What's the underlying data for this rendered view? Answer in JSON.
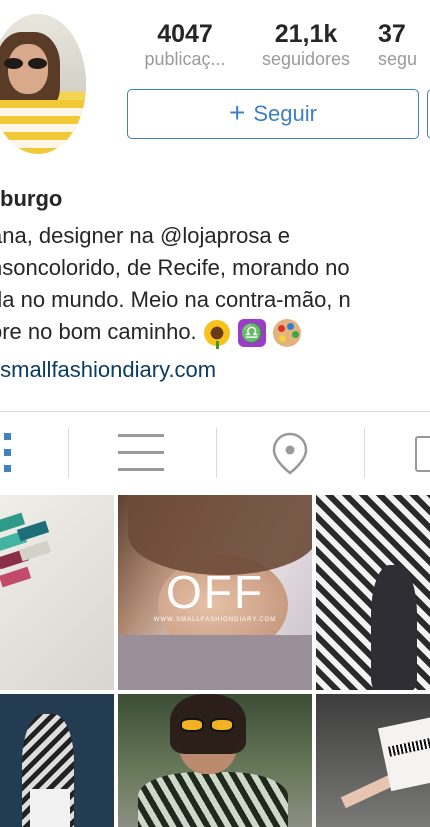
{
  "profile": {
    "stats": [
      {
        "count": "4047",
        "label": "publicaç..."
      },
      {
        "count": "21,1k",
        "label": "seguidores"
      },
      {
        "count": "37",
        "label": "segu"
      }
    ],
    "follow_label": "Seguir",
    "username": "burgo",
    "bio_lines": [
      "ana, designer na @lojaprosa e",
      "nsoncolorido, de Recife, morando no",
      "da no mundo. Meio na contra-mão, n",
      "ore no bom caminho."
    ],
    "bio_emojis": [
      "sunflower-emoji",
      "libra-emoji",
      "palette-emoji"
    ],
    "link": ".smallfashiondiary.com"
  },
  "tabs": [
    {
      "icon": "grid-icon",
      "active": true
    },
    {
      "icon": "list-icon",
      "active": false
    },
    {
      "icon": "location-pin-icon",
      "active": false
    },
    {
      "icon": "tagged-photo-icon",
      "active": false
    }
  ],
  "posts": [
    {
      "kind": "photo"
    },
    {
      "kind": "photo",
      "overlay_text": "OFF",
      "watermark": "WWW.SMALLFASHIONDIARY.COM"
    },
    {
      "kind": "photo"
    },
    {
      "kind": "photo"
    },
    {
      "kind": "photo"
    },
    {
      "kind": "photo"
    }
  ],
  "colors": {
    "accent": "#3f81c3",
    "link": "#0d3c61",
    "muted": "#9a9a9a",
    "divider": "#dbdbdb"
  }
}
